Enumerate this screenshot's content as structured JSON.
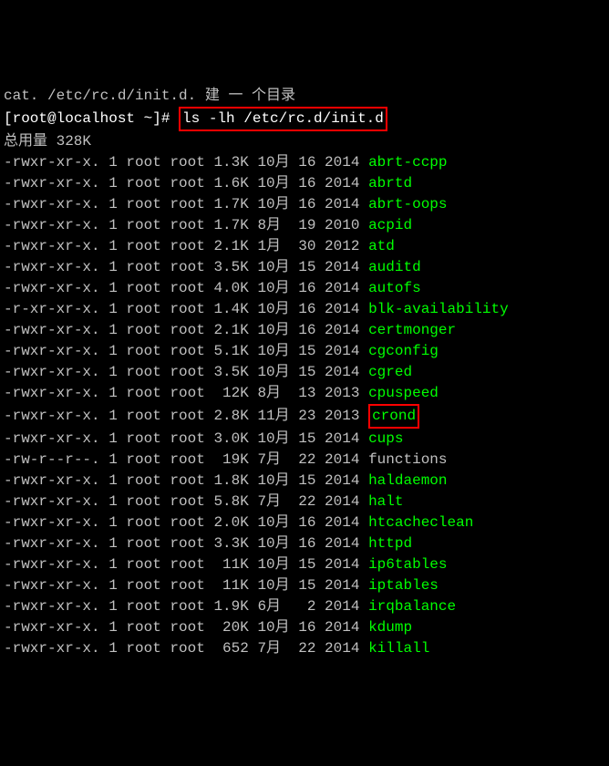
{
  "top_partial": "cat. /etc/rc.d/init.d. 建 一 个目录",
  "prompt": "[root@localhost ~]# ",
  "command": "ls -lh /etc/rc.d/init.d",
  "total_line": "总用量 328K",
  "rows": [
    {
      "perm": "-rwxr-xr-x.",
      "n": "1",
      "o": "root",
      "g": "root",
      "sz": "1.3K",
      "mon": "10月",
      "day": "16",
      "yr": "2014",
      "name": "abrt-ccpp",
      "hi": false
    },
    {
      "perm": "-rwxr-xr-x.",
      "n": "1",
      "o": "root",
      "g": "root",
      "sz": "1.6K",
      "mon": "10月",
      "day": "16",
      "yr": "2014",
      "name": "abrtd",
      "hi": false
    },
    {
      "perm": "-rwxr-xr-x.",
      "n": "1",
      "o": "root",
      "g": "root",
      "sz": "1.7K",
      "mon": "10月",
      "day": "16",
      "yr": "2014",
      "name": "abrt-oops",
      "hi": false
    },
    {
      "perm": "-rwxr-xr-x.",
      "n": "1",
      "o": "root",
      "g": "root",
      "sz": "1.7K",
      "mon": "8月 ",
      "day": "19",
      "yr": "2010",
      "name": "acpid",
      "hi": false
    },
    {
      "perm": "-rwxr-xr-x.",
      "n": "1",
      "o": "root",
      "g": "root",
      "sz": "2.1K",
      "mon": "1月 ",
      "day": "30",
      "yr": "2012",
      "name": "atd",
      "hi": false
    },
    {
      "perm": "-rwxr-xr-x.",
      "n": "1",
      "o": "root",
      "g": "root",
      "sz": "3.5K",
      "mon": "10月",
      "day": "15",
      "yr": "2014",
      "name": "auditd",
      "hi": false
    },
    {
      "perm": "-rwxr-xr-x.",
      "n": "1",
      "o": "root",
      "g": "root",
      "sz": "4.0K",
      "mon": "10月",
      "day": "16",
      "yr": "2014",
      "name": "autofs",
      "hi": false
    },
    {
      "perm": "-r-xr-xr-x.",
      "n": "1",
      "o": "root",
      "g": "root",
      "sz": "1.4K",
      "mon": "10月",
      "day": "16",
      "yr": "2014",
      "name": "blk-availability",
      "hi": false
    },
    {
      "perm": "-rwxr-xr-x.",
      "n": "1",
      "o": "root",
      "g": "root",
      "sz": "2.1K",
      "mon": "10月",
      "day": "16",
      "yr": "2014",
      "name": "certmonger",
      "hi": false
    },
    {
      "perm": "-rwxr-xr-x.",
      "n": "1",
      "o": "root",
      "g": "root",
      "sz": "5.1K",
      "mon": "10月",
      "day": "15",
      "yr": "2014",
      "name": "cgconfig",
      "hi": false
    },
    {
      "perm": "-rwxr-xr-x.",
      "n": "1",
      "o": "root",
      "g": "root",
      "sz": "3.5K",
      "mon": "10月",
      "day": "15",
      "yr": "2014",
      "name": "cgred",
      "hi": false
    },
    {
      "perm": "-rwxr-xr-x.",
      "n": "1",
      "o": "root",
      "g": "root",
      "sz": " 12K",
      "mon": "8月 ",
      "day": "13",
      "yr": "2013",
      "name": "cpuspeed",
      "hi": false
    },
    {
      "perm": "-rwxr-xr-x.",
      "n": "1",
      "o": "root",
      "g": "root",
      "sz": "2.8K",
      "mon": "11月",
      "day": "23",
      "yr": "2013",
      "name": "crond",
      "hi": true
    },
    {
      "perm": "-rwxr-xr-x.",
      "n": "1",
      "o": "root",
      "g": "root",
      "sz": "3.0K",
      "mon": "10月",
      "day": "15",
      "yr": "2014",
      "name": "cups",
      "hi": false
    },
    {
      "perm": "-rw-r--r--.",
      "n": "1",
      "o": "root",
      "g": "root",
      "sz": " 19K",
      "mon": "7月 ",
      "day": "22",
      "yr": "2014",
      "name": "functions",
      "hi": false,
      "plain": true
    },
    {
      "perm": "-rwxr-xr-x.",
      "n": "1",
      "o": "root",
      "g": "root",
      "sz": "1.8K",
      "mon": "10月",
      "day": "15",
      "yr": "2014",
      "name": "haldaemon",
      "hi": false
    },
    {
      "perm": "-rwxr-xr-x.",
      "n": "1",
      "o": "root",
      "g": "root",
      "sz": "5.8K",
      "mon": "7月 ",
      "day": "22",
      "yr": "2014",
      "name": "halt",
      "hi": false
    },
    {
      "perm": "-rwxr-xr-x.",
      "n": "1",
      "o": "root",
      "g": "root",
      "sz": "2.0K",
      "mon": "10月",
      "day": "16",
      "yr": "2014",
      "name": "htcacheclean",
      "hi": false
    },
    {
      "perm": "-rwxr-xr-x.",
      "n": "1",
      "o": "root",
      "g": "root",
      "sz": "3.3K",
      "mon": "10月",
      "day": "16",
      "yr": "2014",
      "name": "httpd",
      "hi": false
    },
    {
      "perm": "-rwxr-xr-x.",
      "n": "1",
      "o": "root",
      "g": "root",
      "sz": " 11K",
      "mon": "10月",
      "day": "15",
      "yr": "2014",
      "name": "ip6tables",
      "hi": false
    },
    {
      "perm": "-rwxr-xr-x.",
      "n": "1",
      "o": "root",
      "g": "root",
      "sz": " 11K",
      "mon": "10月",
      "day": "15",
      "yr": "2014",
      "name": "iptables",
      "hi": false
    },
    {
      "perm": "-rwxr-xr-x.",
      "n": "1",
      "o": "root",
      "g": "root",
      "sz": "1.9K",
      "mon": "6月 ",
      "day": " 2",
      "yr": "2014",
      "name": "irqbalance",
      "hi": false
    },
    {
      "perm": "-rwxr-xr-x.",
      "n": "1",
      "o": "root",
      "g": "root",
      "sz": " 20K",
      "mon": "10月",
      "day": "16",
      "yr": "2014",
      "name": "kdump",
      "hi": false
    },
    {
      "perm": "-rwxr-xr-x.",
      "n": "1",
      "o": "root",
      "g": "root",
      "sz": " 652",
      "mon": "7月 ",
      "day": "22",
      "yr": "2014",
      "name": "killall",
      "hi": false
    }
  ]
}
